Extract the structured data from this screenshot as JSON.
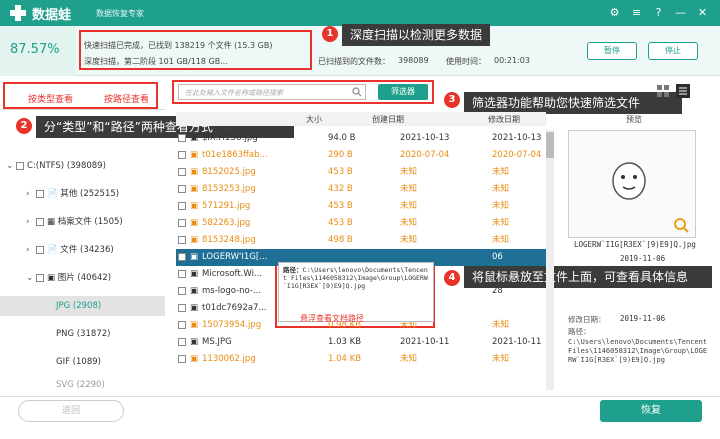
{
  "title": {
    "brand": "数据蛙",
    "subtitle": "数据恢复专家"
  },
  "status": {
    "percent": "87.57%",
    "line1": "快速扫描已完成，已找到 138219 个文件 (15.3 GB)",
    "line2": "深度扫描，第二阶段 101 GB/118 GB...",
    "found_label": "已扫描到的文件数：",
    "found_value": "398089",
    "time_label": "使用时间：",
    "time_value": "00:21:03",
    "pause": "暂停",
    "stop": "停止"
  },
  "callouts": {
    "c1": "深度扫描以检测更多数据",
    "c2": "分“类型”和“路径”两种查看方式",
    "c3": "筛选器功能帮助您快速筛选文件",
    "c4": "将鼠标悬放至文件上面，可查看具体信息",
    "n1": "1",
    "n2": "2",
    "n3": "3",
    "n4": "4"
  },
  "tabs": {
    "type": "按类型查看",
    "path": "按路径查看"
  },
  "search": {
    "placeholder": "在此处输入文件名称或路径搜索",
    "filter": "筛选器"
  },
  "tree": [
    {
      "label": "C:(NTFS) (398089)"
    },
    {
      "label": "其他 (252515)"
    },
    {
      "label": "档案文件 (1505)"
    },
    {
      "label": "文件 (34236)"
    },
    {
      "label": "图片 (40642)"
    },
    {
      "label": "JPG (2908)"
    },
    {
      "label": "PNG (31872)"
    },
    {
      "label": "GIF (1089)"
    },
    {
      "label": "SVG (2290)"
    }
  ],
  "columns": {
    "size": "大小",
    "created": "创建日期",
    "modified": "修改日期",
    "preview": "预览"
  },
  "rows": [
    {
      "name": "$IX.H1SU.jpg",
      "size": "94.0 B",
      "created": "2021-10-13",
      "modified": "2021-10-13"
    },
    {
      "name": "t01e1863ffab...",
      "size": "290 B",
      "created": "2020-07-04",
      "modified": "2020-07-04"
    },
    {
      "name": "8152025.jpg",
      "size": "453 B",
      "created": "未知",
      "modified": "未知"
    },
    {
      "name": "8153253.jpg",
      "size": "432 B",
      "created": "未知",
      "modified": "未知"
    },
    {
      "name": "571291.jpg",
      "size": "453 B",
      "created": "未知",
      "modified": "未知"
    },
    {
      "name": "582263.jpg",
      "size": "453 B",
      "created": "未知",
      "modified": "未知"
    },
    {
      "name": "8153248.jpg",
      "size": "498 B",
      "created": "未知",
      "modified": "未知"
    },
    {
      "name": "LOGERW'I1G[...",
      "size": "",
      "created": "",
      "modified": "06"
    },
    {
      "name": "Microsoft.Wi...",
      "size": "",
      "created": "",
      "modified": "28"
    },
    {
      "name": "ms-logo-no-...",
      "size": "",
      "created": "",
      "modified": "28"
    },
    {
      "name": "t01dc7692a7...",
      "size": "",
      "created": "",
      "modified": ""
    },
    {
      "name": "15073954.jpg",
      "size": "0.98 KB",
      "created": "未知",
      "modified": "未知"
    },
    {
      "name": "MS.JPG",
      "size": "1.03 KB",
      "created": "2021-10-11",
      "modified": "2021-10-11"
    },
    {
      "name": "1130062.jpg",
      "size": "1.04 KB",
      "created": "未知",
      "modified": "未知"
    }
  ],
  "tooltip": {
    "path_label": "路径：",
    "path": "C:\\Users\\lenovo\\Documents\\Tencent Files\\1146058312\\Image\\Group\\LOGERW`I1G[R3EX`[9)E9]Q.jpg",
    "hover_label": "悬浮查看文档路径"
  },
  "preview": {
    "filename": "LOGERW`I1G[R3EX`[9)E9]Q.jpg",
    "date1": "2019-11-06",
    "modified_label": "修改日期：",
    "date2": "2019-11-06",
    "path_label": "路径：",
    "path": "C:\\Users\\lenovo\\Documents\\Tencent Files\\1146058312\\Image\\Group\\LOGERW`I1G[R3EX`[9)E9]Q.jpg"
  },
  "bottom": {
    "back": "返回",
    "recover": "恢复"
  },
  "colors": {
    "accent": "#1ea08d",
    "highlight": "#e8332b",
    "orange": "#e98b12",
    "selected_row": "#1f6e96"
  }
}
